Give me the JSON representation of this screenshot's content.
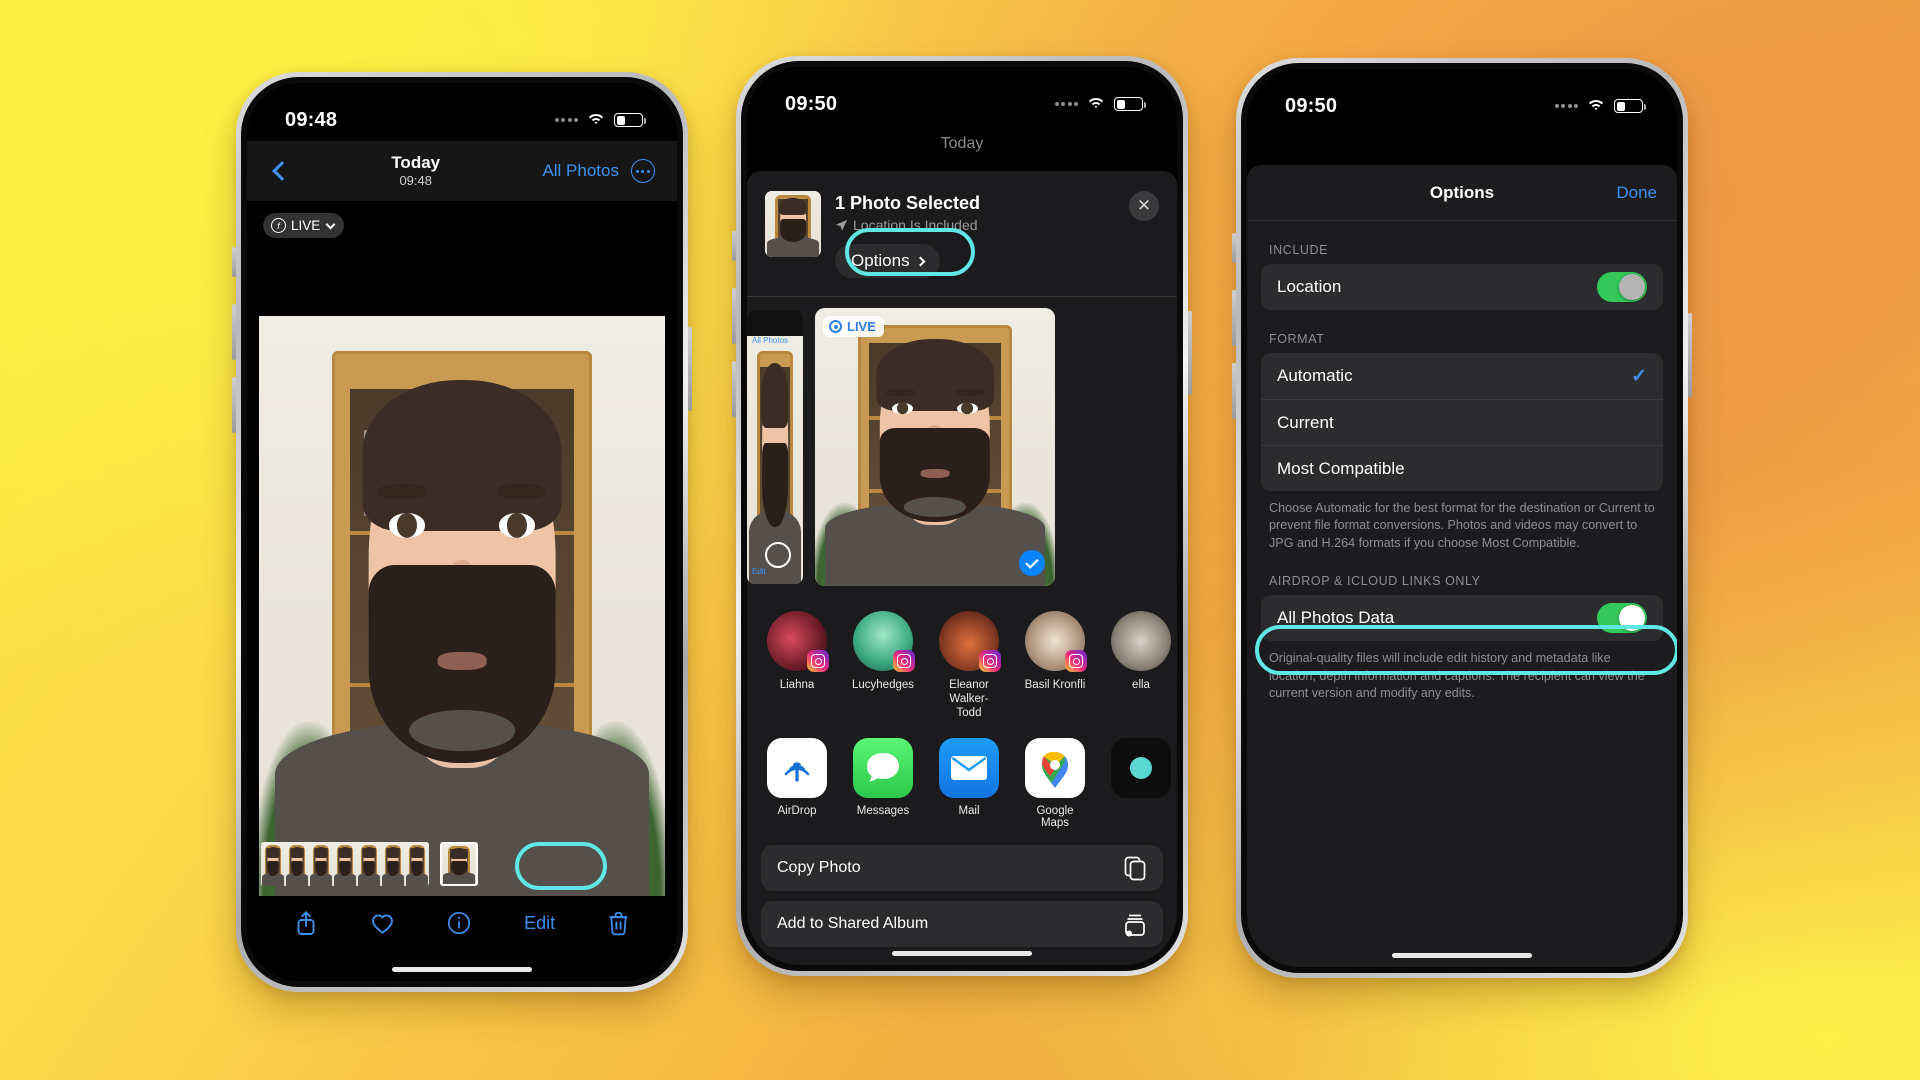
{
  "background": {
    "gradient_from": "#fbee3f",
    "gradient_to": "#eda041"
  },
  "highlight_color": "#5fe7e3",
  "phone1": {
    "status": {
      "time": "09:48",
      "wifi": "wifi-icon",
      "battery": "battery-icon",
      "signal": "signal-dots-icon"
    },
    "nav": {
      "back": "back-chevron-icon",
      "title": "Today",
      "subtitle": "09:48",
      "all_photos": "All Photos",
      "more": "more-options-icon"
    },
    "live_badge": {
      "label": "LIVE",
      "chevron": "chevron-down-icon"
    },
    "toolbar": {
      "share": "share-icon",
      "favorite": "heart-icon",
      "info": "info-icon",
      "edit": "Edit",
      "delete": "trash-icon"
    }
  },
  "phone2": {
    "status": {
      "time": "09:50"
    },
    "dim_title": "Today",
    "dim_all_photos": "All Photos",
    "header": {
      "title": "1 Photo Selected",
      "subtitle": "Location Is Included",
      "options": "Options",
      "close": "close-icon"
    },
    "preview": {
      "live_label": "LIVE",
      "selected": "check-icon"
    },
    "contacts": [
      {
        "name": "Liahna",
        "app_badge": "instagram-icon"
      },
      {
        "name": "Lucyhedges",
        "app_badge": "instagram-icon"
      },
      {
        "name": "Eleanor Walker-Todd",
        "app_badge": "instagram-icon"
      },
      {
        "name": "Basil Kronfli",
        "app_badge": "instagram-icon"
      },
      {
        "name": "ella",
        "app_badge": "instagram-icon"
      }
    ],
    "apps": [
      {
        "name": "AirDrop",
        "icon": "airdrop-icon"
      },
      {
        "name": "Messages",
        "icon": "messages-icon"
      },
      {
        "name": "Mail",
        "icon": "mail-icon"
      },
      {
        "name": "Google Maps",
        "icon": "google-maps-icon"
      },
      {
        "name": "",
        "icon": "more-app-icon"
      }
    ],
    "actions": [
      {
        "label": "Copy Photo",
        "icon": "copy-icon"
      },
      {
        "label": "Add to Shared Album",
        "icon": "shared-album-icon"
      }
    ]
  },
  "phone3": {
    "status": {
      "time": "09:50"
    },
    "nav": {
      "title": "Options",
      "done": "Done"
    },
    "include": {
      "header": "INCLUDE",
      "rows": [
        {
          "label": "Location",
          "toggle": "on"
        }
      ]
    },
    "format": {
      "header": "FORMAT",
      "rows": [
        {
          "label": "Automatic",
          "selected": true
        },
        {
          "label": "Current",
          "selected": false
        },
        {
          "label": "Most Compatible",
          "selected": false
        }
      ],
      "footer": "Choose Automatic for the best format for the destination or Current to prevent file format conversions. Photos and videos may convert to JPG and H.264 formats if you choose Most Compatible."
    },
    "airdrop": {
      "header": "AIRDROP & ICLOUD LINKS ONLY",
      "rows": [
        {
          "label": "All Photos Data",
          "toggle": "on"
        }
      ],
      "footer": "Original-quality files will include edit history and metadata like location, depth information and captions. The recipient can view the current version and modify any edits."
    }
  }
}
